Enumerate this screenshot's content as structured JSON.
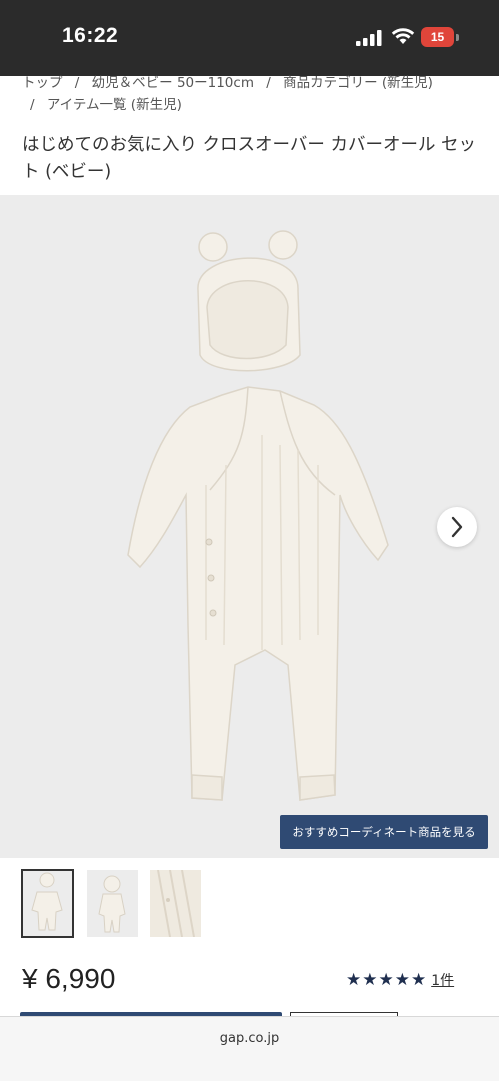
{
  "status_bar": {
    "time": "16:22",
    "battery": "15",
    "icons": [
      "signal-icon",
      "wifi-icon",
      "battery-icon"
    ]
  },
  "breadcrumb": {
    "items": [
      "トップ",
      "幼児＆ベビー 50ー110cm",
      "商品カテゴリー (新生児)",
      "アイテム一覧 (新生児)"
    ],
    "separator": "/"
  },
  "product": {
    "title": "はじめてのお気に入り クロスオーバー カバーオール セット (ベビー)",
    "price": "¥ 6,990",
    "rating_stars": "★★★★★",
    "rating": 5,
    "review_count": "1件"
  },
  "gallery": {
    "recommend_button": "おすすめコーディネート商品を見る",
    "next_icon": "chevron-right-icon",
    "thumbnail_count": 3,
    "selected_index": 0
  },
  "colors": {
    "status_bar": "#2b2b2b",
    "accent_navy": "#2f4a73",
    "battery": "#e0453a",
    "image_bg": "#ececec"
  },
  "browser": {
    "url": "gap.co.jp"
  }
}
